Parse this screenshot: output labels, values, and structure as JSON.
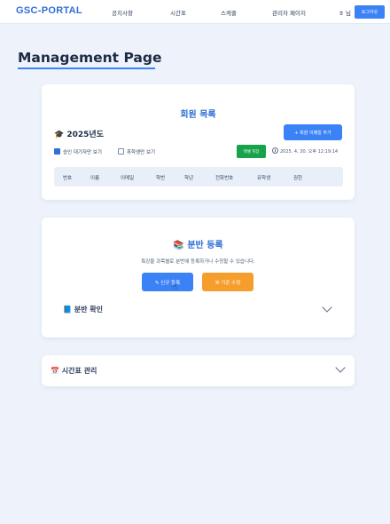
{
  "navbar": {
    "brand": "GSC-PORTAL",
    "links": [
      "공지사항",
      "시간표",
      "스케줄",
      "관리자 페이지"
    ],
    "user": "ㅎ 님",
    "logout": "로그아웃"
  },
  "page": {
    "title": "Management Page"
  },
  "members": {
    "heading": "회원 목록",
    "year": "2025년도",
    "add_button": "+ 회원 이메일 추가",
    "filters": [
      {
        "label": "승인 대기자만 보기",
        "checked": true
      },
      {
        "label": "휴학생만 보기",
        "checked": false
      }
    ],
    "excel_button": "엑셀 저장",
    "timestamp": "2025. 4. 30. 오후 12:19:14",
    "columns": [
      "번호",
      "이름",
      "이메일",
      "학번",
      "학년",
      "전화번호",
      "유학생",
      "권한"
    ]
  },
  "class_register": {
    "heading": "분반 등록",
    "icon": "📚",
    "description": "특강을 과목별로 분반에 등록하거나 수정할 수 있습니다.",
    "new_button": "✎ 신규 등록",
    "edit_button": "⚒ 기존 수정",
    "confirm_heading": "분반 확인",
    "confirm_icon": "📘"
  },
  "timetable": {
    "heading": "시간표 관리",
    "icon": "📅"
  },
  "colors": {
    "accent": "#3b82f6",
    "brand": "#2f6fd6",
    "excel": "#16a34a",
    "edit": "#f59e2b"
  }
}
